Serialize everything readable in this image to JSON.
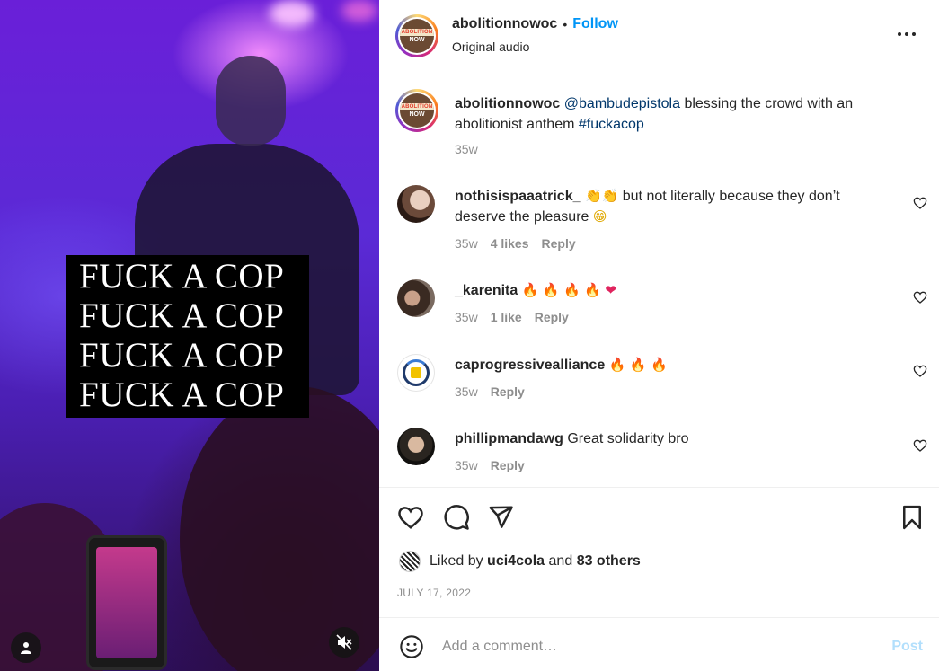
{
  "video": {
    "caption_lines": [
      "FUCK A COP",
      "FUCK A COP",
      "FUCK A COP",
      "FUCK A COP"
    ]
  },
  "header": {
    "username": "abolitionnowoc",
    "separator": "•",
    "follow_label": "Follow",
    "audio": "Original audio",
    "logo_text": [
      "ABOLITION",
      "NOW"
    ]
  },
  "post": {
    "username": "abolitionnowoc",
    "mention": "@bambudepistola",
    "text": " blessing the crowd with an abolitionist anthem ",
    "hashtag": "#fuckacop",
    "time": "35w"
  },
  "comments": [
    {
      "username": "nothisispaaatrick_",
      "text_parts": [
        "👏👏",
        " but not literally because they don’t deserve the pleasure ",
        "😁"
      ],
      "time": "35w",
      "likes": "4 likes",
      "reply": "Reply"
    },
    {
      "username": "_karenita",
      "emojis": [
        "🔥",
        "🔥",
        "🔥",
        "🔥",
        "❤"
      ],
      "time": "35w",
      "likes": "1 like",
      "reply": "Reply"
    },
    {
      "username": "caprogressivealliance",
      "emojis": [
        "🔥",
        "🔥",
        "🔥"
      ],
      "time": "35w",
      "reply": "Reply"
    },
    {
      "username": "phillipmandawg",
      "text": "Great solidarity bro",
      "time": "35w",
      "reply": "Reply"
    }
  ],
  "likes": {
    "prefix": "Liked by",
    "user": "uci4cola",
    "and": "and",
    "others": "83 others"
  },
  "date": "JULY 17, 2022",
  "composer": {
    "placeholder": "Add a comment…",
    "post_label": "Post"
  },
  "colors": {
    "follow_blue": "#0095f6",
    "link_navy": "#00376b",
    "muted_gray": "#8e8e8e",
    "post_disabled": "#b2dffc"
  }
}
